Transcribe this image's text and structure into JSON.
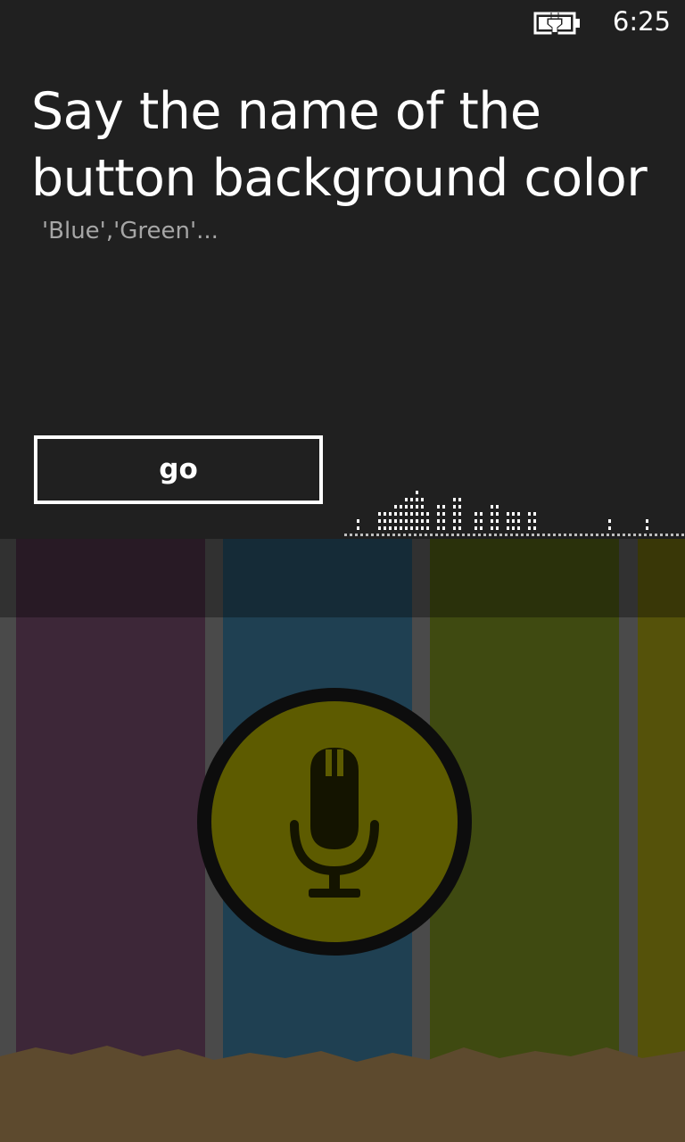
{
  "status_bar": {
    "time": "6:25",
    "battery_icon": "battery-charging-icon"
  },
  "speech_prompt": {
    "title_line1": "Say the name of the",
    "title_line2": "button background color",
    "hint": "'Blue','Green'...",
    "go_button_label": "go",
    "audio_meter_icon": "audio-level-meter"
  },
  "background_app": {
    "stripe_colors": [
      "#5a3a53",
      "#2f5f7a",
      "#5e6d1a",
      "#7e7a10"
    ],
    "mic_button_color": "#5d5b00",
    "mic_icon": "microphone-icon"
  }
}
